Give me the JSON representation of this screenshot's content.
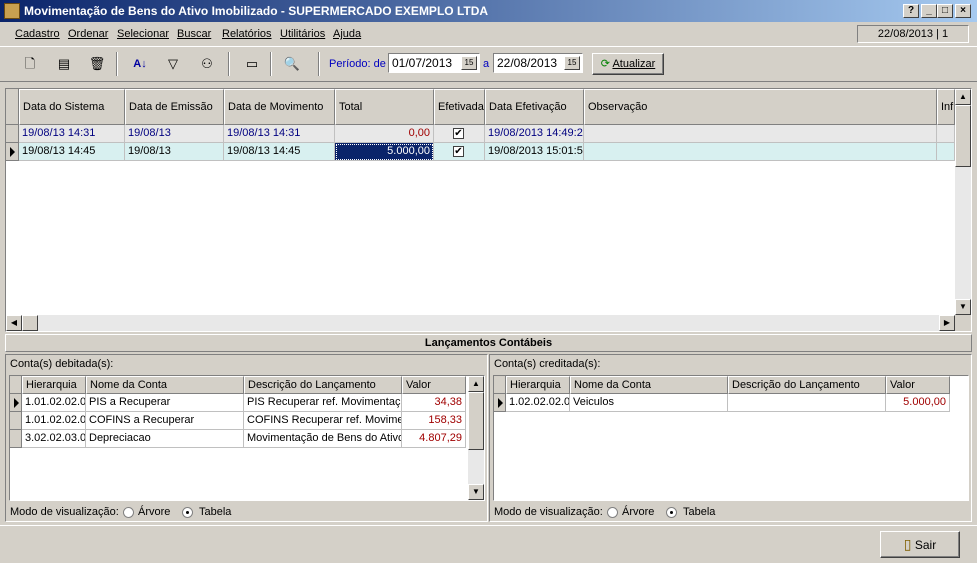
{
  "window": {
    "title": "Movimentação de Bens do Ativo Imobilizado - SUPERMERCADO EXEMPLO LTDA"
  },
  "menu": {
    "items": [
      "Cadastro",
      "Ordenar",
      "Selecionar",
      "Buscar",
      "Relatórios",
      "Utilitários",
      "Ajuda"
    ],
    "status": "22/08/2013 | 1"
  },
  "toolbar": {
    "periodo_label": "Período: de",
    "date_from": "01/07/2013",
    "a_label": "a",
    "date_to": "22/08/2013",
    "atualizar_label": "Atualizar",
    "cal_label": "15"
  },
  "icons": {
    "new": "new-doc-icon",
    "edit": "edit-doc-icon",
    "delete": "trash-icon",
    "sort": "sort-az-icon",
    "filter": "filter-icon",
    "search": "binoculars-icon",
    "print": "print-icon",
    "preview": "preview-icon",
    "refresh": "refresh-icon",
    "exit": "door-exit-icon"
  },
  "main_grid": {
    "columns": [
      "Data do Sistema",
      "Data de Emissão",
      "Data de Movimento",
      "Total",
      "Efetivada",
      "Data Efetivação",
      "Observação",
      "Inf"
    ],
    "rows": [
      [
        "19/08/13  14:31",
        "19/08/13",
        "19/08/13  14:31",
        "0,00",
        "✔",
        "19/08/2013 14:49:2",
        ""
      ],
      [
        "19/08/13  14:45",
        "19/08/13",
        "19/08/13  14:45",
        "5.000,00",
        "✔",
        "19/08/2013 15:01:5",
        ""
      ]
    ]
  },
  "lancamentos": {
    "title": "Lançamentos Contábeis",
    "debit": {
      "label": "Conta(s) debitada(s):",
      "columns": [
        "Hierarquia",
        "Nome da Conta",
        "Descrição do Lançamento",
        "Valor"
      ],
      "rows": [
        [
          "1.01.02.02.0",
          "PIS a Recuperar",
          "PIS Recuperar ref. Movimentaçã",
          "34,38"
        ],
        [
          "1.01.02.02.0",
          "COFINS a Recuperar",
          "COFINS Recuperar ref. Movimer",
          "158,33"
        ],
        [
          "3.02.02.03.0",
          "Depreciacao",
          "Movimentação de Bens do Ativo",
          "4.807,29"
        ]
      ],
      "modo_label": "Modo de visualização:",
      "opt_arvore": "Árvore",
      "opt_tabela": "Tabela"
    },
    "credit": {
      "label": "Conta(s) creditada(s):",
      "columns": [
        "Hierarquia",
        "Nome da Conta",
        "Descrição do Lançamento",
        "Valor"
      ],
      "rows": [
        [
          "1.02.02.02.0",
          "Veiculos",
          "",
          "5.000,00"
        ]
      ],
      "modo_label": "Modo de visualização:",
      "opt_arvore": "Árvore",
      "opt_tabela": "Tabela"
    }
  },
  "footer": {
    "sair_label": "Sair"
  }
}
